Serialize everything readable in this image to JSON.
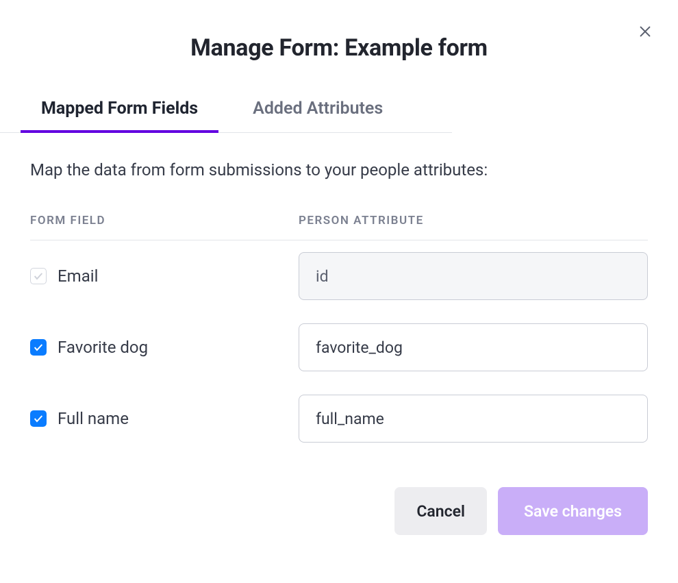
{
  "title": "Manage Form: Example form",
  "tabs": [
    {
      "label": "Mapped Form Fields",
      "active": true
    },
    {
      "label": "Added Attributes",
      "active": false
    }
  ],
  "description": "Map the data from form submissions to your people attributes:",
  "columns": {
    "form_field": "FORM FIELD",
    "person_attribute": "PERSON ATTRIBUTE"
  },
  "rows": [
    {
      "checked": true,
      "disabled": true,
      "field_label": "Email",
      "attribute_value": "id",
      "readonly": true
    },
    {
      "checked": true,
      "disabled": false,
      "field_label": "Favorite dog",
      "attribute_value": "favorite_dog",
      "readonly": false
    },
    {
      "checked": true,
      "disabled": false,
      "field_label": "Full name",
      "attribute_value": "full_name",
      "readonly": false
    }
  ],
  "buttons": {
    "cancel": "Cancel",
    "save": "Save changes"
  }
}
